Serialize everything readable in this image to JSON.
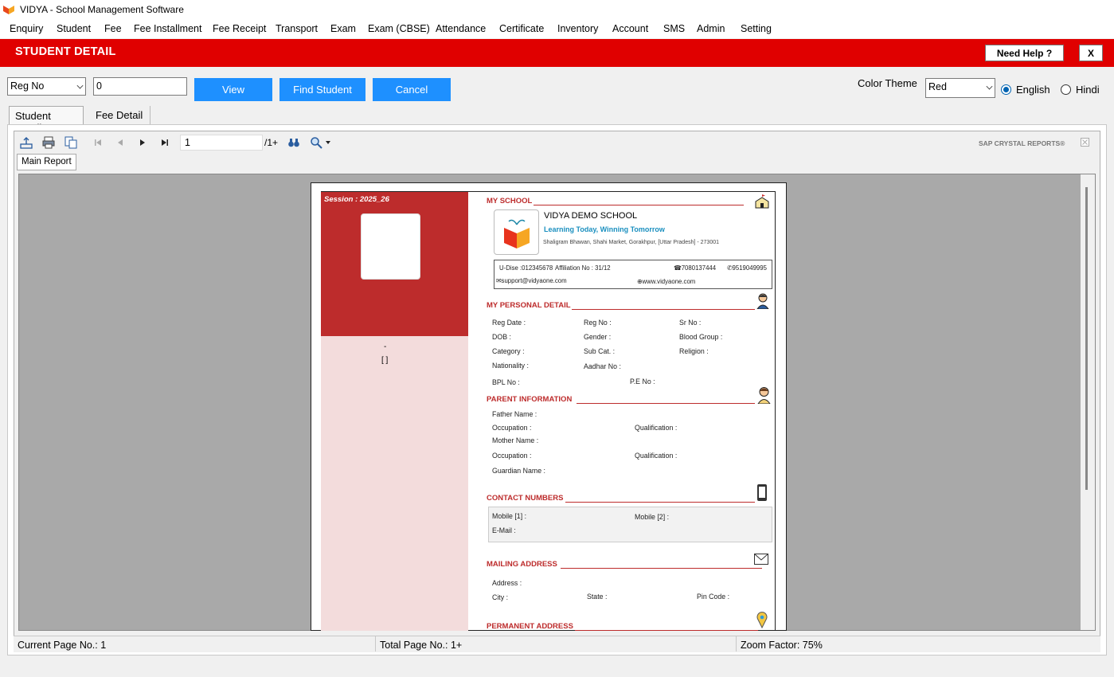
{
  "window": {
    "title": "VIDYA - School Management Software"
  },
  "menu": [
    "Enquiry",
    "Student",
    "Fee",
    "Fee Installment",
    "Fee Receipt",
    "Transport",
    "Exam",
    "Exam (CBSE)",
    "Attendance",
    "Certificate",
    "Inventory",
    "Account",
    "SMS",
    "Admin",
    "Setting"
  ],
  "header": {
    "title": "STUDENT DETAIL",
    "help_label": "Need Help ?",
    "close_label": "X",
    "color": "#e00000"
  },
  "search": {
    "field_selected": "Reg No",
    "value": "0",
    "view_label": "View",
    "find_label": "Find Student",
    "cancel_label": "Cancel"
  },
  "theme": {
    "label": "Color Theme",
    "selected": "Red",
    "english_label": "English",
    "hindi_label": "Hindi",
    "language_selected": "English"
  },
  "tabs": [
    "Student Detail",
    "Fee Detail"
  ],
  "viewer": {
    "page_value": "1",
    "page_total": "/1+",
    "brand": "SAP CRYSTAL REPORTS®",
    "report_tab": "Main Report"
  },
  "report": {
    "session": "Session : 2025_26",
    "dash": "-",
    "brackets": "[ ]",
    "my_school": "MY SCHOOL",
    "school_name": "VIDYA DEMO SCHOOL",
    "tagline": "Learning Today, Winning Tomorrow",
    "school_address": "Shaligram Bhawan, Shahi Market, Gorakhpur, [Uttar Pradesh] - 273001",
    "udise": "U-Dise :012345678",
    "affiliation": "Affiliation No : 31/12",
    "phone1": "7080137444",
    "phone2": "9519049995",
    "email": "support@vidyaone.com",
    "website": "www.vidyaone.com",
    "personal_title": "MY PERSONAL DETAIL",
    "personal": {
      "reg_date": "Reg Date :",
      "reg_no": "Reg No :",
      "sr_no": "Sr No :",
      "dob": "DOB :",
      "gender": "Gender :",
      "blood": "Blood Group :",
      "category": "Category :",
      "subcat": "Sub Cat. :",
      "religion": "Religion :",
      "nationality": "Nationality :",
      "aadhar": "Aadhar No :",
      "bpl": "BPL No :",
      "pe": "P.E No :"
    },
    "parent_title": "PARENT INFORMATION",
    "parent": {
      "father": "Father Name :",
      "occ1": "Occupation :",
      "qual1": "Qualification :",
      "mother": "Mother Name :",
      "occ2": "Occupation :",
      "qual2": "Qualification :",
      "guardian": "Guardian Name :"
    },
    "contact_title": "CONTACT NUMBERS",
    "contact": {
      "mobile1": "Mobile [1] :",
      "mobile2": "Mobile [2] :",
      "email": "E-Mail :"
    },
    "mailing_title": "MAILING ADDRESS",
    "mailing": {
      "address": "Address :",
      "city": "City :",
      "state": "State :",
      "pin": "Pin Code :"
    },
    "permanent_title": "PERMANENT ADDRESS"
  },
  "status": {
    "current": "Current Page No.: 1",
    "total": "Total Page No.: 1+",
    "zoom": "Zoom Factor: 75%"
  }
}
